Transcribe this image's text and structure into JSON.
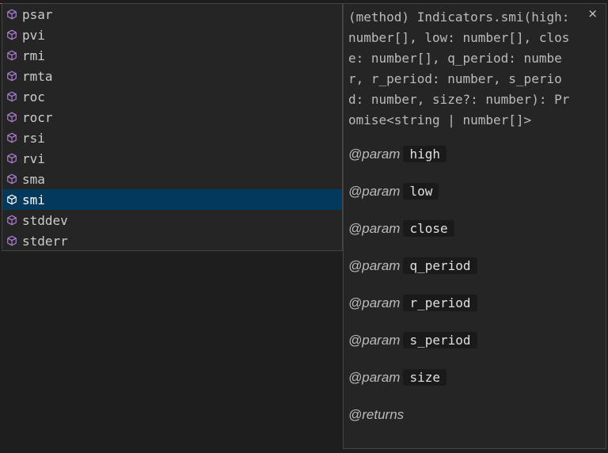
{
  "suggestions": {
    "items": [
      {
        "label": "psar",
        "icon": "method-cube-icon"
      },
      {
        "label": "pvi",
        "icon": "method-cube-icon"
      },
      {
        "label": "rmi",
        "icon": "method-cube-icon"
      },
      {
        "label": "rmta",
        "icon": "method-cube-icon"
      },
      {
        "label": "roc",
        "icon": "method-cube-icon"
      },
      {
        "label": "rocr",
        "icon": "method-cube-icon"
      },
      {
        "label": "rsi",
        "icon": "method-cube-icon"
      },
      {
        "label": "rvi",
        "icon": "method-cube-icon"
      },
      {
        "label": "sma",
        "icon": "method-cube-icon"
      },
      {
        "label": "smi",
        "icon": "method-cube-icon",
        "selected": true
      },
      {
        "label": "stddev",
        "icon": "method-cube-icon"
      },
      {
        "label": "stderr",
        "icon": "method-cube-icon"
      }
    ],
    "icon_color": "#b180d7",
    "selected_bg": "#04395e"
  },
  "details": {
    "signature": "(method) Indicators.smi(high: number[], low: number[], close: number[], q_period: number, r_period: number, s_period: number, size?: number): Promise<string | number[]>",
    "close_label": "×",
    "params": [
      {
        "tag": "@param",
        "name": "high"
      },
      {
        "tag": "@param",
        "name": "low"
      },
      {
        "tag": "@param",
        "name": "close"
      },
      {
        "tag": "@param",
        "name": "q_period"
      },
      {
        "tag": "@param",
        "name": "r_period"
      },
      {
        "tag": "@param",
        "name": "s_period"
      },
      {
        "tag": "@param",
        "name": "size"
      }
    ],
    "returns_tag": "@returns"
  }
}
